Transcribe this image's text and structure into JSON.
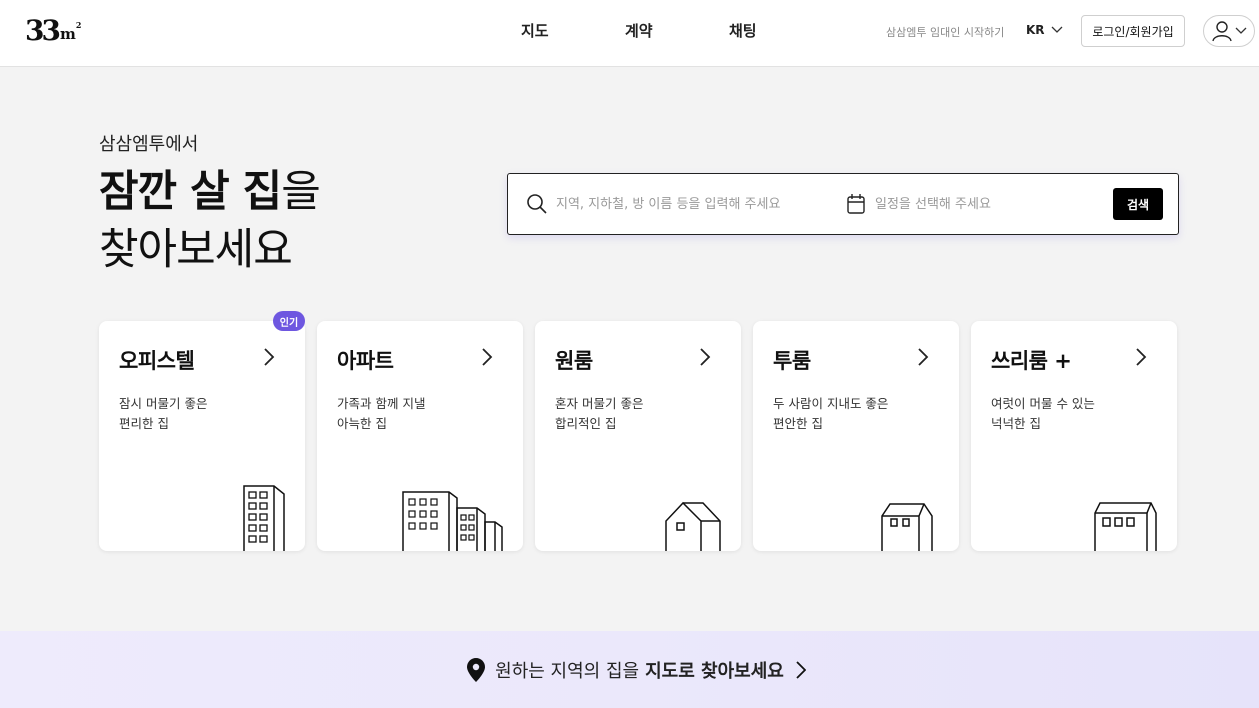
{
  "header": {
    "logo_main": "33",
    "logo_unit": "m",
    "logo_sup": "2",
    "nav": [
      "지도",
      "계약",
      "채팅"
    ],
    "host_link": "삼삼엠투 임대인 시작하기",
    "language": "KR",
    "login_label": "로그인/회원가입",
    "icons": {
      "language": "chevron-down-icon",
      "profile": "user-icon"
    }
  },
  "hero": {
    "intro": "삼삼엠투에서",
    "headline_bold": "잠깐 살 집",
    "headline_suffix": "을",
    "headline_line2": "찾아보세요"
  },
  "search": {
    "location_placeholder": "지역, 지하철, 방 이름 등을 입력해 주세요",
    "location_value": "",
    "date_placeholder": "일정을 선택해 주세요",
    "date_value": "",
    "button_label": "검색",
    "icons": {
      "location": "search-icon",
      "date": "calendar-icon"
    }
  },
  "categories": [
    {
      "title": "오피스텔",
      "desc": [
        "잠시 머물기 좋은",
        "편리한 집"
      ],
      "badge": "인기",
      "icon": "officetel-building-icon"
    },
    {
      "title": "아파트",
      "desc": [
        "가족과 함께 지낼",
        "아늑한 집"
      ],
      "icon": "apartment-buildings-icon"
    },
    {
      "title": "원룸",
      "desc": [
        "혼자 머물기 좋은",
        "합리적인 집"
      ],
      "icon": "small-house-icon"
    },
    {
      "title": "투룸",
      "desc": [
        "두 사람이 지내도 좋은",
        "편안한 집"
      ],
      "icon": "medium-house-icon"
    },
    {
      "title": "쓰리룸 +",
      "desc": [
        "여럿이 머물 수 있는",
        "넉넉한 집"
      ],
      "icon": "large-house-icon"
    }
  ],
  "banner": {
    "text": "원하는 지역의 집을",
    "text_bold": "지도로 찾아보세요",
    "icons": {
      "pin": "map-pin-icon",
      "arrow": "chevron-right-icon"
    }
  },
  "colors": {
    "accent": "#6e57e0",
    "background": "#f3f3f3",
    "banner": "#ebe8fb",
    "button": "#000000"
  }
}
